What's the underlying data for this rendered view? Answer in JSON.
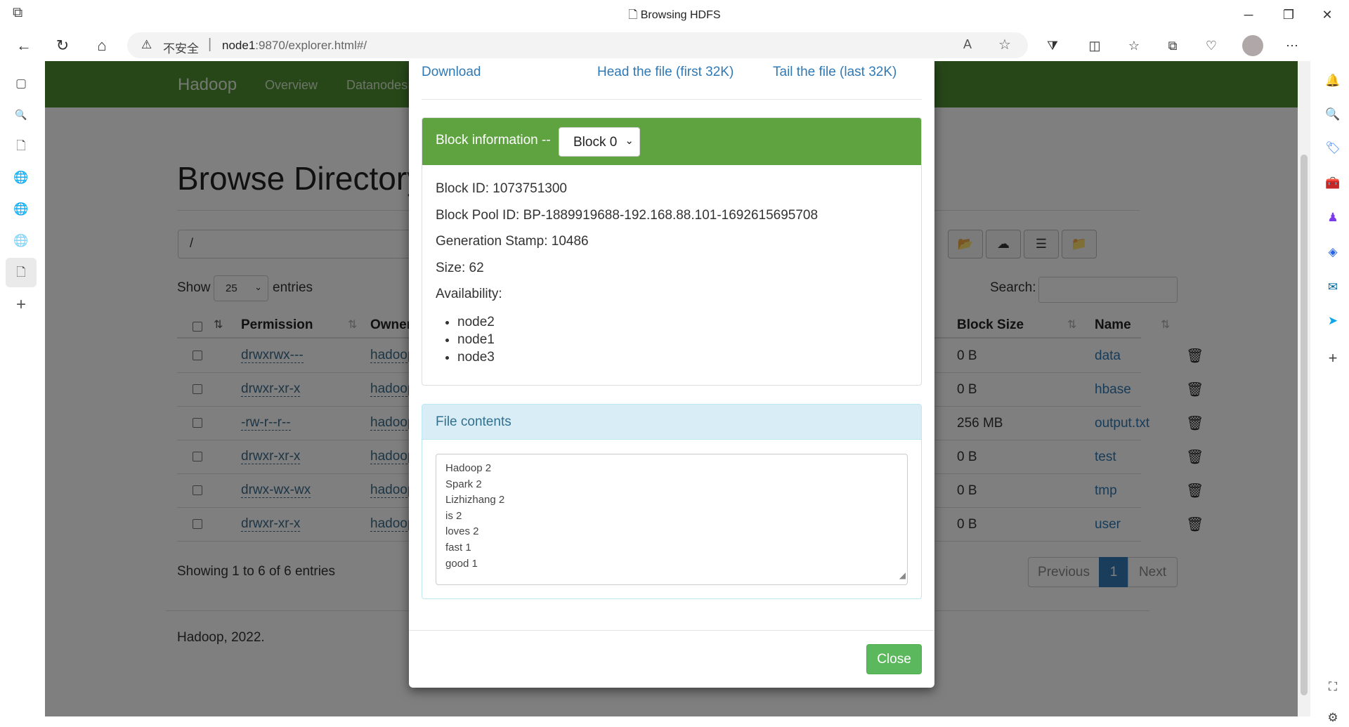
{
  "browser": {
    "tab_title": "Browsing HDFS",
    "insecure_label": "不安全",
    "url_host": "node1",
    "url_rest": ":9870/explorer.html#/"
  },
  "hadoop": {
    "brand": "Hadoop",
    "nav": [
      "Overview",
      "Datanodes"
    ],
    "page_title": "Browse Directory",
    "path_value": "/",
    "show_label": "Show",
    "entries_label": "entries",
    "page_length": "25",
    "search_label": "Search:",
    "columns": {
      "permission": "Permission",
      "owner": "Owner",
      "block_size": "Block Size",
      "name": "Name"
    },
    "rows": [
      {
        "permission": "drwxrwx---",
        "owner": "hadoop",
        "block_size": "0 B",
        "name": "data"
      },
      {
        "permission": "drwxr-xr-x",
        "owner": "hadoop",
        "block_size": "0 B",
        "name": "hbase"
      },
      {
        "permission": "-rw-r--r--",
        "owner": "hadoop",
        "block_size": "256 MB",
        "name": "output.txt"
      },
      {
        "permission": "drwxr-xr-x",
        "owner": "hadoop",
        "block_size": "0 B",
        "name": "test"
      },
      {
        "permission": "drwx-wx-wx",
        "owner": "hadoop",
        "block_size": "0 B",
        "name": "tmp"
      },
      {
        "permission": "drwxr-xr-x",
        "owner": "hadoop",
        "block_size": "0 B",
        "name": "user"
      }
    ],
    "showing": "Showing 1 to 6 of 6 entries",
    "pager": {
      "previous": "Previous",
      "current": "1",
      "next": "Next"
    },
    "footer": "Hadoop, 2022."
  },
  "modal": {
    "download": "Download",
    "head": "Head the file (first 32K)",
    "tail": "Tail the file (last 32K)",
    "block_info_label": "Block information --",
    "block_selected": "Block 0",
    "block_id": "Block ID: 1073751300",
    "block_pool_id": "Block Pool ID: BP-1889919688-192.168.88.101-1692615695708",
    "generation_stamp": "Generation Stamp: 10486",
    "size": "Size: 62",
    "availability_label": "Availability:",
    "availability": [
      "node2",
      "node1",
      "node3"
    ],
    "file_contents_label": "File contents",
    "file_contents": "Hadoop 2\nSpark 2\nLizhizhang 2\nis 2\nloves 2\nfast 1\ngood 1",
    "close": "Close"
  },
  "colors": {
    "hadoop_nav": "#4f8e32",
    "block_header": "#5ea33f",
    "close_button": "#5cb85c",
    "pager_active": "#337ab7"
  }
}
